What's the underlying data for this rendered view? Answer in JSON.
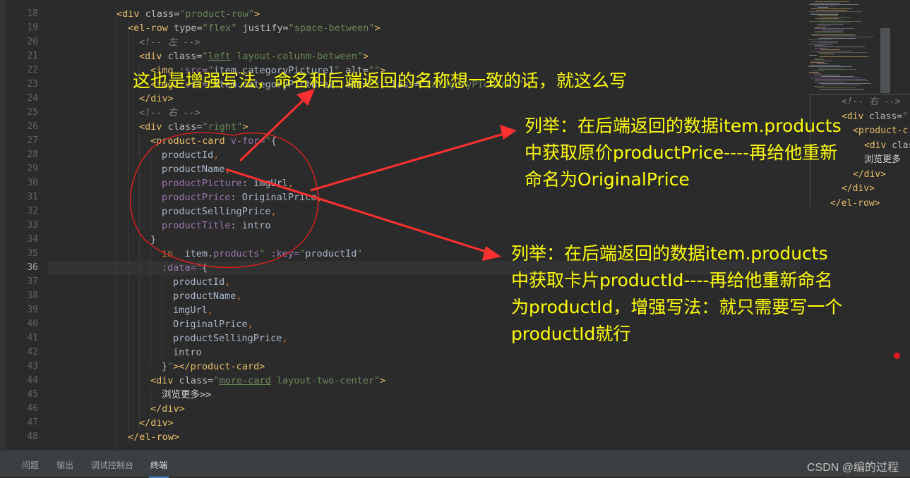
{
  "editor": {
    "active_line": "36",
    "lines": [
      {
        "n": "18",
        "segs": [
          [
            "t",
            "<div "
          ],
          [
            "a",
            "class="
          ],
          [
            "s",
            "\"product-row\""
          ],
          [
            "t",
            ">"
          ]
        ]
      },
      {
        "n": "19",
        "segs": [
          [
            "t",
            "<el-row "
          ],
          [
            "a",
            "type="
          ],
          [
            "s",
            "\"flex\" "
          ],
          [
            "a",
            "justify="
          ],
          [
            "s",
            "\"space-between\""
          ],
          [
            "t",
            ">"
          ]
        ]
      },
      {
        "n": "20",
        "segs": [
          [
            "c",
            "<!-- 左 -->"
          ]
        ]
      },
      {
        "n": "21",
        "segs": [
          [
            "t",
            "<div "
          ],
          [
            "a",
            "class="
          ],
          [
            "s",
            "\""
          ],
          [
            "sul",
            "left"
          ],
          [
            "s",
            " layout-colunm-between\""
          ],
          [
            "t",
            ">"
          ]
        ]
      },
      {
        "n": "22",
        "segs": [
          [
            "t",
            "<img "
          ],
          [
            "p",
            ":src="
          ],
          [
            "s",
            "\""
          ],
          [
            "plain",
            "item.categoryPicture1"
          ],
          [
            "s",
            "\" "
          ],
          [
            "a",
            "alt="
          ],
          [
            "s",
            "\"\""
          ],
          [
            "t",
            ">"
          ]
        ]
      },
      {
        "n": "23",
        "segs": [
          [
            "t",
            "<img "
          ],
          [
            "p",
            ":src="
          ],
          [
            "s",
            "\""
          ],
          [
            "plain",
            "item.categoryPicture2"
          ],
          [
            "s",
            "\" "
          ],
          [
            "a",
            "alt="
          ],
          [
            "s",
            "\"\" "
          ],
          [
            "a",
            "class="
          ],
          [
            "s",
            "\"categoryPicture2\""
          ],
          [
            "t",
            ">"
          ]
        ]
      },
      {
        "n": "24",
        "segs": [
          [
            "t",
            "</div>"
          ]
        ]
      },
      {
        "n": "25",
        "segs": [
          [
            "c",
            "<!-- 右 -->"
          ]
        ]
      },
      {
        "n": "26",
        "segs": [
          [
            "t",
            "<div "
          ],
          [
            "a",
            "class="
          ],
          [
            "s",
            "\"right\""
          ],
          [
            "t",
            ">"
          ]
        ]
      },
      {
        "n": "27",
        "segs": [
          [
            "t",
            "<product-card "
          ],
          [
            "p",
            "v-for="
          ],
          [
            "s",
            "\""
          ],
          [
            "plain",
            "{"
          ]
        ]
      },
      {
        "n": "28",
        "segs": [
          [
            "plain",
            "productId"
          ],
          [
            "k",
            ","
          ]
        ]
      },
      {
        "n": "29",
        "segs": [
          [
            "plain",
            "productName"
          ],
          [
            "k",
            ","
          ]
        ]
      },
      {
        "n": "30",
        "segs": [
          [
            "p",
            "productPicture"
          ],
          [
            "plain",
            ": imgUrl"
          ],
          [
            "k",
            ","
          ]
        ]
      },
      {
        "n": "31",
        "segs": [
          [
            "p",
            "productPrice"
          ],
          [
            "plain",
            ": OriginalPrice"
          ],
          [
            "k",
            ","
          ]
        ]
      },
      {
        "n": "32",
        "segs": [
          [
            "plain",
            "productSellingPrice"
          ],
          [
            "k",
            ","
          ]
        ]
      },
      {
        "n": "33",
        "segs": [
          [
            "p",
            "productTitle"
          ],
          [
            "plain",
            ": intro"
          ]
        ]
      },
      {
        "n": "34",
        "segs": [
          [
            "plain",
            "}"
          ]
        ]
      },
      {
        "n": "35",
        "segs": [
          [
            "k",
            "in "
          ],
          [
            "plain",
            " item."
          ],
          [
            "p",
            "products"
          ],
          [
            "s",
            "\" "
          ],
          [
            "p",
            ":key="
          ],
          [
            "s",
            "\""
          ],
          [
            "plain",
            "productId"
          ],
          [
            "s",
            "\""
          ]
        ]
      },
      {
        "n": "36",
        "segs": [
          [
            "p",
            ":data="
          ],
          [
            "s",
            "\""
          ],
          [
            "plain",
            "{"
          ]
        ]
      },
      {
        "n": "37",
        "segs": [
          [
            "plain",
            "productId"
          ],
          [
            "k",
            ","
          ]
        ]
      },
      {
        "n": "38",
        "segs": [
          [
            "plain",
            "productName"
          ],
          [
            "k",
            ","
          ]
        ]
      },
      {
        "n": "39",
        "segs": [
          [
            "plain",
            "imgUrl"
          ],
          [
            "k",
            ","
          ]
        ]
      },
      {
        "n": "40",
        "segs": [
          [
            "plain",
            "OriginalPrice"
          ],
          [
            "k",
            ","
          ]
        ]
      },
      {
        "n": "41",
        "segs": [
          [
            "plain",
            "productSellingPrice"
          ],
          [
            "k",
            ","
          ]
        ]
      },
      {
        "n": "42",
        "segs": [
          [
            "plain",
            "intro"
          ]
        ]
      },
      {
        "n": "43",
        "segs": [
          [
            "plain",
            "}"
          ],
          [
            "s",
            "\""
          ],
          [
            "t",
            "></product-card>"
          ]
        ]
      },
      {
        "n": "44",
        "segs": [
          [
            "t",
            "<div "
          ],
          [
            "a",
            "class="
          ],
          [
            "s",
            "\""
          ],
          [
            "sul",
            "more-card"
          ],
          [
            "s",
            " layout-two-center\""
          ],
          [
            "t",
            ">"
          ]
        ]
      },
      {
        "n": "45",
        "segs": [
          [
            "cn",
            "浏览更多>>"
          ]
        ]
      },
      {
        "n": "46",
        "segs": [
          [
            "t",
            "</div>"
          ]
        ]
      },
      {
        "n": "47",
        "segs": [
          [
            "t",
            "</div>"
          ]
        ]
      },
      {
        "n": "48",
        "segs": [
          [
            "t",
            "</el-row>"
          ]
        ]
      }
    ]
  },
  "popup": {
    "lines": [
      {
        "segs": [
          [
            "c",
            "<!-- 右 -->"
          ]
        ]
      },
      {
        "segs": [
          [
            "t",
            "<div "
          ],
          [
            "a",
            "class="
          ],
          [
            "s",
            "\""
          ]
        ]
      },
      {
        "segs": [
          [
            "t",
            "<product-c"
          ]
        ]
      },
      {
        "segs": [
          [
            "t",
            "<div "
          ],
          [
            "a",
            "class"
          ]
        ]
      },
      {
        "segs": [
          [
            "cn",
            "浏览更多"
          ]
        ]
      },
      {
        "segs": [
          [
            "t",
            "</div>"
          ]
        ]
      },
      {
        "segs": [
          [
            "t",
            "</div>"
          ]
        ]
      },
      {
        "segs": [
          [
            "t",
            "</el-row>"
          ]
        ]
      }
    ]
  },
  "bottom_tabs": [
    {
      "label": "问题",
      "active": false
    },
    {
      "label": "输出",
      "active": false
    },
    {
      "label": "调试控制台",
      "active": false
    },
    {
      "label": "终端",
      "active": true
    }
  ],
  "watermark": "CSDN @编的过程",
  "annotations": {
    "a1": "这也是增强写法，命名和后端返回的名称想一致的话，就这么写",
    "a2": [
      "列举：在后端返回的数据item.products",
      "中获取原价productPrice----再给他重新",
      "命名为OriginalPrice"
    ],
    "a3": [
      "列举：在后端返回的数据item.products",
      "中获取卡片productId----再给他重新命名",
      "为productId，增强写法：就只需要写一个",
      "productId就行"
    ]
  },
  "colors": {
    "annotation": "#ffff00",
    "arrow": "#ff3030",
    "circle": "#e02020"
  }
}
